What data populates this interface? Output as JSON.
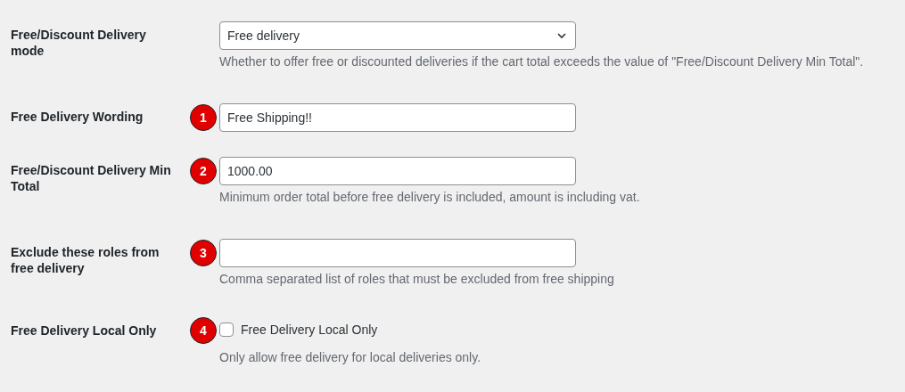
{
  "fields": [
    {
      "kind": "select",
      "label": "Free/Discount Delivery mode",
      "value": "Free delivery",
      "description": "Whether to offer free or discounted deliveries if the cart total exceeds the value of \"Free/Discount Delivery Min Total\"."
    },
    {
      "kind": "text",
      "label": "Free Delivery Wording",
      "badge": "1",
      "value": "Free Shipping!!"
    },
    {
      "kind": "text",
      "label": "Free/Discount Delivery Min Total",
      "badge": "2",
      "value": "1000.00",
      "description": "Minimum order total before free delivery is included, amount is including vat."
    },
    {
      "kind": "text",
      "label": "Exclude these roles from free delivery",
      "badge": "3",
      "description": "Comma separated list of roles that must be excluded from free shipping"
    },
    {
      "kind": "checkbox",
      "label": "Free Delivery Local Only",
      "badge": "4",
      "checkbox_label": "Free Delivery Local Only",
      "checked": false,
      "description": "Only allow free delivery for local deliveries only."
    }
  ]
}
